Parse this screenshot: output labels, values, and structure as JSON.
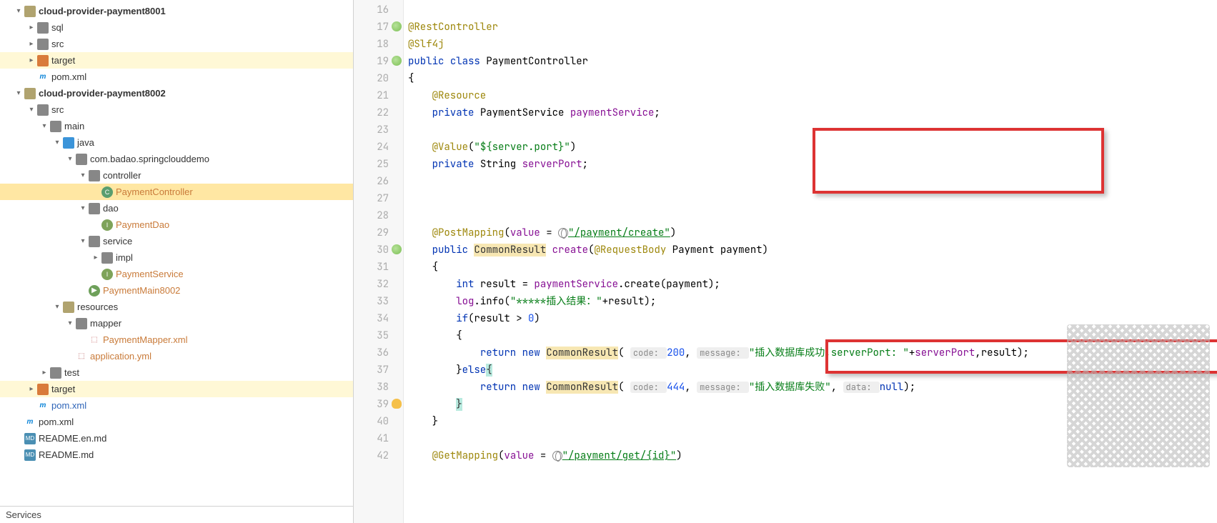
{
  "tree": [
    {
      "indent": 0,
      "chev": "▾",
      "icon": "fold-res",
      "label": "cloud-provider-payment8001",
      "bold": true
    },
    {
      "indent": 1,
      "chev": "▸",
      "icon": "fold",
      "label": "sql"
    },
    {
      "indent": 1,
      "chev": "▸",
      "icon": "fold",
      "label": "src"
    },
    {
      "indent": 1,
      "chev": "▸",
      "icon": "fold-tgt",
      "label": "target",
      "hl": true
    },
    {
      "indent": 1,
      "chev": "",
      "icon": "mvn",
      "iconText": "m",
      "label": "pom.xml"
    },
    {
      "indent": 0,
      "chev": "▾",
      "icon": "fold-res",
      "label": "cloud-provider-payment8002",
      "bold": true
    },
    {
      "indent": 1,
      "chev": "▾",
      "icon": "fold",
      "label": "src"
    },
    {
      "indent": 2,
      "chev": "▾",
      "icon": "fold",
      "label": "main"
    },
    {
      "indent": 3,
      "chev": "▾",
      "icon": "fold-src",
      "label": "java"
    },
    {
      "indent": 4,
      "chev": "▾",
      "icon": "fold",
      "label": "com.badao.springclouddemo"
    },
    {
      "indent": 5,
      "chev": "▾",
      "icon": "fold",
      "label": "controller"
    },
    {
      "indent": 6,
      "chev": "",
      "icon": "cls",
      "iconText": "C",
      "label": "PaymentController",
      "orange": true,
      "sel": true
    },
    {
      "indent": 5,
      "chev": "▾",
      "icon": "fold",
      "label": "dao"
    },
    {
      "indent": 6,
      "chev": "",
      "icon": "iface",
      "iconText": "I",
      "label": "PaymentDao",
      "orange": true
    },
    {
      "indent": 5,
      "chev": "▾",
      "icon": "fold",
      "label": "service"
    },
    {
      "indent": 6,
      "chev": "▸",
      "icon": "fold",
      "label": "impl"
    },
    {
      "indent": 6,
      "chev": "",
      "icon": "iface",
      "iconText": "I",
      "label": "PaymentService",
      "orange": true
    },
    {
      "indent": 5,
      "chev": "",
      "icon": "app",
      "iconText": "▶",
      "label": "PaymentMain8002",
      "orange": true
    },
    {
      "indent": 3,
      "chev": "▾",
      "icon": "fold-res",
      "label": "resources"
    },
    {
      "indent": 4,
      "chev": "▾",
      "icon": "fold",
      "label": "mapper"
    },
    {
      "indent": 5,
      "chev": "",
      "icon": "xml",
      "iconText": "⬚",
      "label": "PaymentMapper.xml",
      "orange": true
    },
    {
      "indent": 4,
      "chev": "",
      "icon": "yml",
      "iconText": "⬚",
      "label": "application.yml",
      "orange": true
    },
    {
      "indent": 2,
      "chev": "▸",
      "icon": "fold",
      "label": "test"
    },
    {
      "indent": 1,
      "chev": "▸",
      "icon": "fold-tgt",
      "label": "target",
      "hl": true
    },
    {
      "indent": 1,
      "chev": "",
      "icon": "mvn",
      "iconText": "m",
      "label": "pom.xml",
      "blue": true
    },
    {
      "indent": 0,
      "chev": "",
      "icon": "mvn",
      "iconText": "m",
      "label": "pom.xml"
    },
    {
      "indent": 0,
      "chev": "",
      "icon": "md",
      "iconText": "MD",
      "label": "README.en.md"
    },
    {
      "indent": 0,
      "chev": "",
      "icon": "md",
      "iconText": "MD",
      "label": "README.md"
    }
  ],
  "services": "Services",
  "code": {
    "start": 16,
    "lines": [
      {
        "n": 16,
        "tok": [
          [
            "",
            ""
          ]
        ]
      },
      {
        "n": 17,
        "mark": "gr",
        "tok": [
          [
            "ann",
            "@RestController"
          ]
        ]
      },
      {
        "n": 18,
        "tok": [
          [
            "ann",
            "@Slf4j"
          ]
        ]
      },
      {
        "n": 19,
        "mark": "gr",
        "tok": [
          [
            "kw",
            "public "
          ],
          [
            "kw",
            "class "
          ],
          [
            "typ",
            "PaymentController"
          ]
        ]
      },
      {
        "n": 20,
        "tok": [
          [
            "typ",
            "{"
          ]
        ]
      },
      {
        "n": 21,
        "tok": [
          [
            "typ",
            "    "
          ],
          [
            "ann",
            "@Resource"
          ]
        ]
      },
      {
        "n": 22,
        "tok": [
          [
            "typ",
            "    "
          ],
          [
            "kw",
            "private "
          ],
          [
            "typ",
            "PaymentService "
          ],
          [
            "fld",
            "paymentService"
          ],
          [
            "typ",
            ";"
          ]
        ]
      },
      {
        "n": 23,
        "tok": [
          [
            "",
            ""
          ]
        ]
      },
      {
        "n": 24,
        "tok": [
          [
            "typ",
            "    "
          ],
          [
            "ann",
            "@Value"
          ],
          [
            "typ",
            "("
          ],
          [
            "str",
            "\"${server.port}\""
          ],
          [
            "typ",
            ")"
          ]
        ]
      },
      {
        "n": 25,
        "tok": [
          [
            "typ",
            "    "
          ],
          [
            "kw",
            "private "
          ],
          [
            "typ",
            "String "
          ],
          [
            "fld",
            "serverPort"
          ],
          [
            "typ",
            ";"
          ]
        ]
      },
      {
        "n": 26,
        "tok": [
          [
            "",
            ""
          ]
        ]
      },
      {
        "n": 27,
        "tok": [
          [
            "",
            ""
          ]
        ]
      },
      {
        "n": 28,
        "tok": [
          [
            "",
            ""
          ]
        ]
      },
      {
        "n": 29,
        "tok": [
          [
            "typ",
            "    "
          ],
          [
            "ann",
            "@PostMapping"
          ],
          [
            "typ",
            "("
          ],
          [
            "fld",
            "value"
          ],
          [
            "typ",
            " = "
          ],
          [
            "globe",
            ""
          ],
          [
            "str-u",
            "\"/payment/create\""
          ],
          [
            "typ",
            ")"
          ]
        ]
      },
      {
        "n": 30,
        "mark": "gr",
        "tok": [
          [
            "typ",
            "    "
          ],
          [
            "kw",
            "public "
          ],
          [
            "hl-y",
            "CommonResult"
          ],
          [
            "typ",
            " "
          ],
          [
            "fld",
            "create"
          ],
          [
            "typ",
            "("
          ],
          [
            "ann",
            "@RequestBody"
          ],
          [
            "typ",
            " Payment payment)"
          ]
        ]
      },
      {
        "n": 31,
        "tok": [
          [
            "typ",
            "    {"
          ]
        ]
      },
      {
        "n": 32,
        "tok": [
          [
            "typ",
            "        "
          ],
          [
            "kw",
            "int "
          ],
          [
            "typ",
            "result = "
          ],
          [
            "fld",
            "paymentService"
          ],
          [
            "typ",
            ".create(payment);"
          ]
        ]
      },
      {
        "n": 33,
        "tok": [
          [
            "typ",
            "        "
          ],
          [
            "fld",
            "log"
          ],
          [
            "typ",
            ".info("
          ],
          [
            "str",
            "\"*****插入结果：\""
          ],
          [
            "typ",
            "+result);"
          ]
        ]
      },
      {
        "n": 34,
        "tok": [
          [
            "typ",
            "        "
          ],
          [
            "kw",
            "if"
          ],
          [
            "typ",
            "(result > "
          ],
          [
            "num",
            "0"
          ],
          [
            "typ",
            ")"
          ]
        ]
      },
      {
        "n": 35,
        "tok": [
          [
            "typ",
            "        {"
          ]
        ]
      },
      {
        "n": 36,
        "tok": [
          [
            "typ",
            "            "
          ],
          [
            "kw",
            "return "
          ],
          [
            "kw",
            "new "
          ],
          [
            "hl-y",
            "CommonResult"
          ],
          [
            "typ",
            "( "
          ],
          [
            "hint",
            "code: "
          ],
          [
            "num",
            "200"
          ],
          [
            "typ",
            ", "
          ],
          [
            "hint",
            "message: "
          ],
          [
            "str",
            "\"插入数据库成功,serverPort: \""
          ],
          [
            "typ",
            "+"
          ],
          [
            "fld",
            "serverPort"
          ],
          [
            "typ",
            ",result);"
          ]
        ]
      },
      {
        "n": 37,
        "tok": [
          [
            "typ",
            "        }"
          ],
          [
            "kw",
            "else"
          ],
          [
            "hl-c",
            "{"
          ]
        ]
      },
      {
        "n": 38,
        "tok": [
          [
            "typ",
            "            "
          ],
          [
            "kw",
            "return "
          ],
          [
            "kw",
            "new "
          ],
          [
            "hl-y",
            "CommonResult"
          ],
          [
            "typ",
            "( "
          ],
          [
            "hint",
            "code: "
          ],
          [
            "num",
            "444"
          ],
          [
            "typ",
            ", "
          ],
          [
            "hint",
            "message: "
          ],
          [
            "str",
            "\"插入数据库失败\""
          ],
          [
            "typ",
            ", "
          ],
          [
            "hint",
            "data: "
          ],
          [
            "kw",
            "null"
          ],
          [
            "typ",
            ");"
          ]
        ]
      },
      {
        "n": 39,
        "mark": "bulb",
        "tok": [
          [
            "typ",
            "        "
          ],
          [
            "hl-c",
            "}"
          ]
        ]
      },
      {
        "n": 40,
        "tok": [
          [
            "typ",
            "    }"
          ]
        ]
      },
      {
        "n": 41,
        "tok": [
          [
            "",
            ""
          ]
        ]
      },
      {
        "n": 42,
        "tok": [
          [
            "typ",
            "    "
          ],
          [
            "ann",
            "@GetMapping"
          ],
          [
            "typ",
            "("
          ],
          [
            "fld",
            "value"
          ],
          [
            "typ",
            " = "
          ],
          [
            "globe",
            ""
          ],
          [
            "str-u",
            "\"/payment/get/{id}\""
          ],
          [
            "typ",
            ")"
          ]
        ]
      }
    ]
  }
}
